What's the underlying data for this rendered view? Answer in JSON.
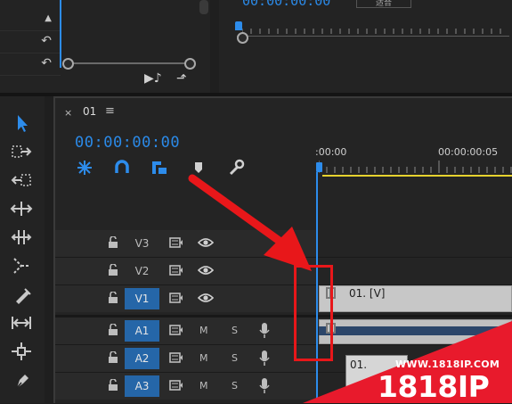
{
  "source_monitor": {
    "row_glyphs": [
      "▲",
      "↶",
      "↶"
    ],
    "buttons": [
      "▶♪",
      "⬏"
    ]
  },
  "program_monitor": {
    "timecode": "00:00:00:00",
    "label": "适合"
  },
  "sequence": {
    "tab_close": "×",
    "tab_name": "01",
    "tab_menu": "≡",
    "timecode": "00:00:00:00",
    "ruler_labels": [
      ":00:00",
      "00:00:00:05"
    ]
  },
  "tracks": {
    "video": [
      {
        "name": "V3",
        "targeted": false
      },
      {
        "name": "V2",
        "targeted": false
      },
      {
        "name": "V1",
        "targeted": true
      }
    ],
    "audio": [
      {
        "name": "A1",
        "targeted": true,
        "mute": "M",
        "solo": "S"
      },
      {
        "name": "A2",
        "targeted": true,
        "mute": "M",
        "solo": "S"
      },
      {
        "name": "A3",
        "targeted": true,
        "mute": "M",
        "solo": "S"
      }
    ]
  },
  "clips": {
    "video_clip_label": "01. [V]",
    "tooltip_label": "01."
  },
  "colors": {
    "accent_blue": "#2b8ae8",
    "track_target_blue": "#2566a8",
    "work_area_yellow": "#e6d22e",
    "annotation_red": "#e8171a"
  },
  "watermark": {
    "url": "WWW.1818IP.COM",
    "brand": "1818IP"
  }
}
